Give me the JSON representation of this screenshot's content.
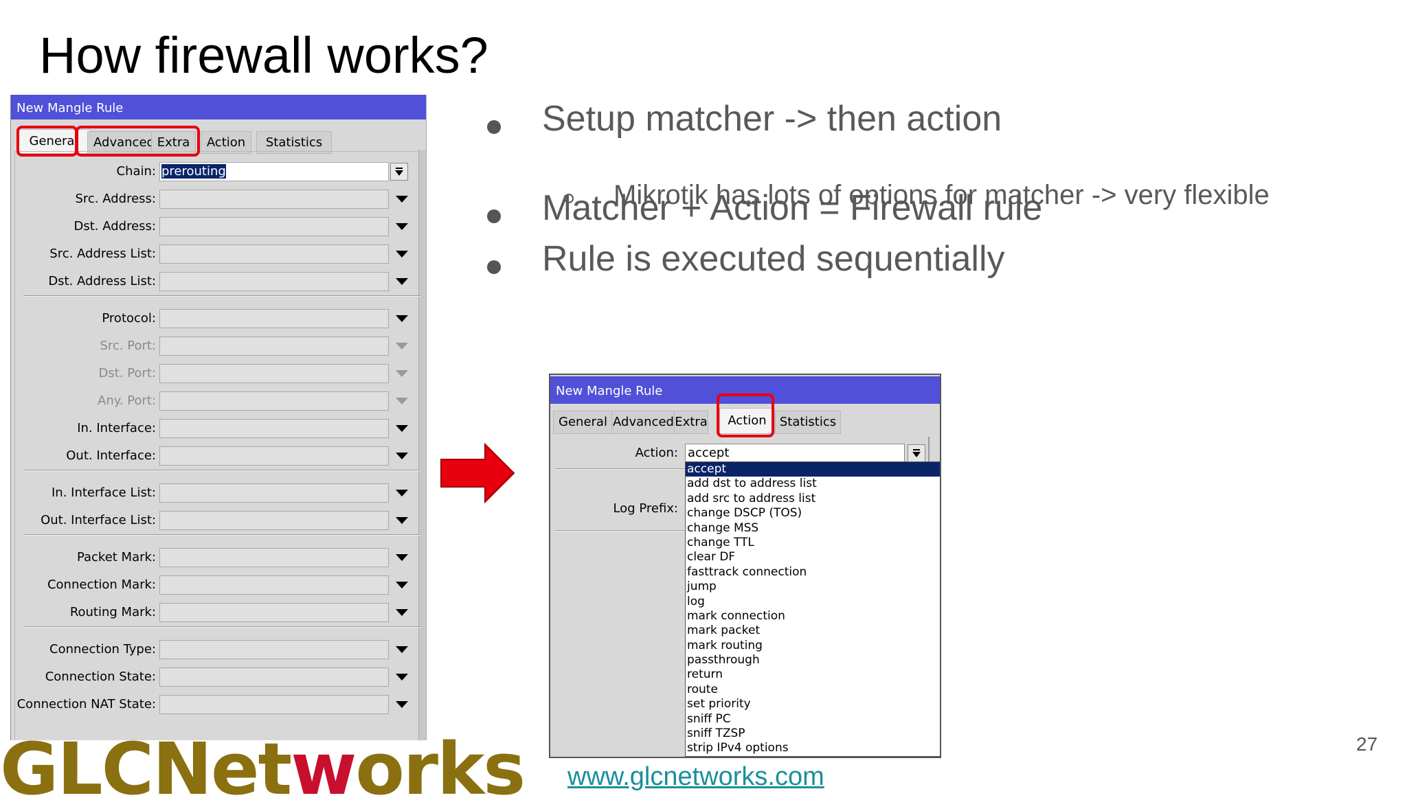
{
  "slide": {
    "title": "How firewall works?",
    "page_number": "27",
    "url": "www.glcnetworks.com",
    "logo": {
      "part1": "GLCNet",
      "part2": "w",
      "part3": "orks"
    }
  },
  "bullets": [
    {
      "text": "Setup matcher -> then action",
      "level": 1
    },
    {
      "text": "Mikrotik has lots of options for matcher -> very flexible",
      "level": 2
    },
    {
      "text": "Matcher + Action = Firewall rule",
      "level": 1
    },
    {
      "text": "Rule is executed sequentially",
      "level": 1
    }
  ],
  "window_general": {
    "title": "New Mangle Rule",
    "tabs": [
      "General",
      "Advanced",
      "Extra",
      "Action",
      "Statistics"
    ],
    "selected_tab": "General",
    "chain_label": "Chain:",
    "chain_value": "prerouting",
    "fields": [
      {
        "label": "Src. Address:",
        "enabled": true
      },
      {
        "label": "Dst. Address:",
        "enabled": true
      },
      {
        "label": "Src. Address List:",
        "enabled": true
      },
      {
        "label": "Dst. Address List:",
        "enabled": true
      },
      {
        "label": "Protocol:",
        "enabled": true
      },
      {
        "label": "Src. Port:",
        "enabled": false
      },
      {
        "label": "Dst. Port:",
        "enabled": false
      },
      {
        "label": "Any. Port:",
        "enabled": false
      },
      {
        "label": "In. Interface:",
        "enabled": true
      },
      {
        "label": "Out. Interface:",
        "enabled": true
      },
      {
        "label": "In. Interface List:",
        "enabled": true
      },
      {
        "label": "Out. Interface List:",
        "enabled": true
      },
      {
        "label": "Packet Mark:",
        "enabled": true
      },
      {
        "label": "Connection Mark:",
        "enabled": true
      },
      {
        "label": "Routing Mark:",
        "enabled": true
      },
      {
        "label": "Connection Type:",
        "enabled": true
      },
      {
        "label": "Connection State:",
        "enabled": true
      },
      {
        "label": "Connection NAT State:",
        "enabled": true
      }
    ]
  },
  "window_action": {
    "title": "New Mangle Rule",
    "tabs": [
      "General",
      "Advanced",
      "Extra",
      "Action",
      "Statistics"
    ],
    "selected_tab": "Action",
    "action_label": "Action:",
    "action_value": "accept",
    "log_prefix_label": "Log Prefix:",
    "options": [
      "accept",
      "add dst to address list",
      "add src to address list",
      "change DSCP (TOS)",
      "change MSS",
      "change TTL",
      "clear DF",
      "fasttrack connection",
      "jump",
      "log",
      "mark connection",
      "mark packet",
      "mark routing",
      "passthrough",
      "return",
      "route",
      "set priority",
      "sniff PC",
      "sniff TZSP",
      "strip IPv4 options"
    ],
    "highlighted_option": "accept"
  },
  "colors": {
    "titlebar": "#5050d8",
    "highlight_box": "#e8000e",
    "arrow": "#e8000e",
    "selection": "#0a246a"
  }
}
